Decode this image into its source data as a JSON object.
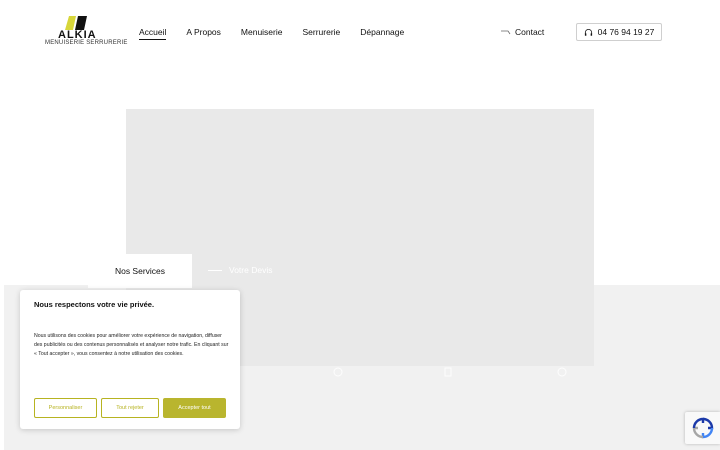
{
  "brand": {
    "name": "ALKIA",
    "tagline": "MENUISERIE SERRURERIE",
    "accent_color": "#d7d63a"
  },
  "nav": {
    "items": [
      {
        "label": "Accueil",
        "active": true
      },
      {
        "label": "A Propos",
        "active": false
      },
      {
        "label": "Menuiserie",
        "active": false
      },
      {
        "label": "Serrurerie",
        "active": false
      },
      {
        "label": "Dépannage",
        "active": false
      }
    ],
    "contact_label": "Contact",
    "phone": "04 76 94 19 27"
  },
  "hero": {
    "tab_services": "Nos Services",
    "tab_devis": "Votre Devis"
  },
  "cookie_banner": {
    "title": "Nous respectons votre vie privée.",
    "body": "Nous utilisons des cookies pour améliorer votre expérience de navigation, diffuser des publicités ou des contenus personnalisés et analyser notre trafic. En cliquant sur « Tout accepter », vous consentez à notre utilisation des cookies.",
    "customize_label": "Personnaliser",
    "reject_label": "Tout rejeter",
    "accept_label": "Accepter tout",
    "button_color": "#b9b52e"
  },
  "icons": {
    "phone": "headset-icon",
    "contact": "arrow-icon",
    "recaptcha": "recaptcha-icon"
  }
}
